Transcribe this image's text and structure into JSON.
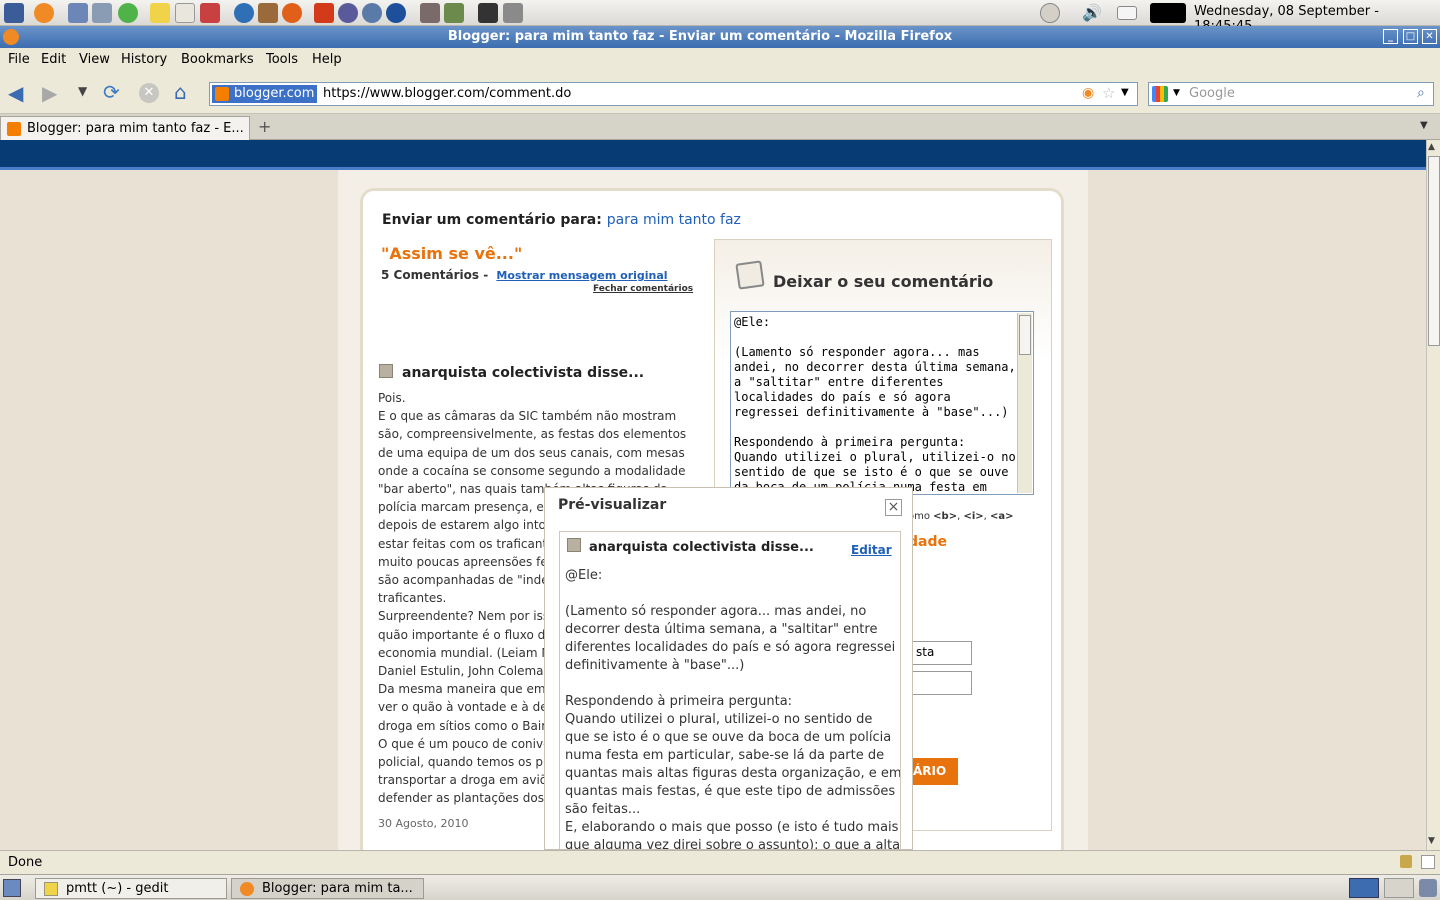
{
  "system": {
    "clock": "Wednesday, 08 September - 18:45:45"
  },
  "window": {
    "title": "Blogger: para mim tanto faz - Enviar um comentário - Mozilla Firefox"
  },
  "menu": [
    "File",
    "Edit",
    "View",
    "History",
    "Bookmarks",
    "Tools",
    "Help"
  ],
  "nav": {
    "domain": "blogger.com",
    "url": "https://www.blogger.com/comment.do",
    "search_placeholder": "Google"
  },
  "tab": {
    "label": "Blogger: para mim tanto faz - E..."
  },
  "page": {
    "send_comment_prefix": "Enviar um comentário para:",
    "blog_name": "para mim tanto faz",
    "post_title": "\"Assim se vê...\"",
    "comments_count": "5 Comentários",
    "sep": "-",
    "show_original": "Mostrar mensagem original",
    "close_comments": "Fechar comentários",
    "comment_author": "anarquista colectivista disse...",
    "comment_lines": [
      "Pois.",
      "E o que as câmaras da SIC também não mostram",
      "são, compreensivelmente, as festas dos elementos",
      "de uma equipa de um dos seus canais, com mesas",
      "onde a cocaína se consome segundo a modalidade",
      "\"bar aberto\", nas quais também altas figuras da",
      "polícia marcam presença, e",
      "depois de estarem algo intox",
      "estar feitas com os traficant",
      "muito poucas apreensões fe",
      "são acompanhadas de \"inde",
      "traficantes.",
      "Surpreendente? Nem por isso",
      "quão importante é o fluxo de",
      "economia mundial. (Leiam M",
      "Daniel Estulin, John Coleman",
      "Da mesma maneira que em",
      "ver o quão à vontade e à de",
      "droga em sítios como o Bair",
      "O que é um pouco de conivê",
      "policial, quando temos os pr",
      "transportar a droga em aviõ",
      "defender as plantações dos"
    ],
    "comment_date": "30 Agosto, 2010",
    "leave_comment": "Deixar o seu comentário",
    "textarea_value": "@Ele:\n\n(Lamento só responder agora... mas\nandei, no decorrer desta última semana,\na \"saltitar\" entre diferentes\nlocalidades do país e só agora\nregressei definitivamente à \"base\"...)\n\nRespondendo à primeira pergunta:\nQuando utilizei o plural, utilizei-o no\nsentido de que se isto é o que se ouve\nda boca de um polícia numa festa em",
    "html_hint_tail": "omo",
    "html_tags": [
      "<b>",
      "<i>",
      "<a>"
    ],
    "identity_tail": "dade",
    "name_field_tail": "sta",
    "publish_tail": "ÁRIO"
  },
  "preview": {
    "title": "Pré-visualizar",
    "close": "×",
    "author": "anarquista colectivista disse...",
    "edit": "Editar",
    "text": "@Ele:\n\n(Lamento só responder agora... mas andei, no\ndecorrer desta última semana, a \"saltitar\" entre\ndiferentes localidades do país e só agora regressei\ndefinitivamente à \"base\"...)\n\nRespondendo à primeira pergunta:\nQuando utilizei o plural, utilizei-o no sentido de\nque se isto é o que se ouve da boca de um polícia\nnuma festa em particular, sabe-se lá da parte de\nquantas mais altas figuras desta organização, e em\nquantas mais festas, é que este tipo de admissões\nsão feitas...\nE, elaborando o mais que posso (e isto é tudo mais\nque alguma vez direi sobre o assunto): o que a alta"
  },
  "status": "Done",
  "taskbar": {
    "gedit": "pmtt (~) - gedit",
    "firefox": "Blogger: para mim ta..."
  },
  "colors": {
    "accent_orange": "#e8720c",
    "link_blue": "#2060b8",
    "header_blue": "#063b74"
  }
}
